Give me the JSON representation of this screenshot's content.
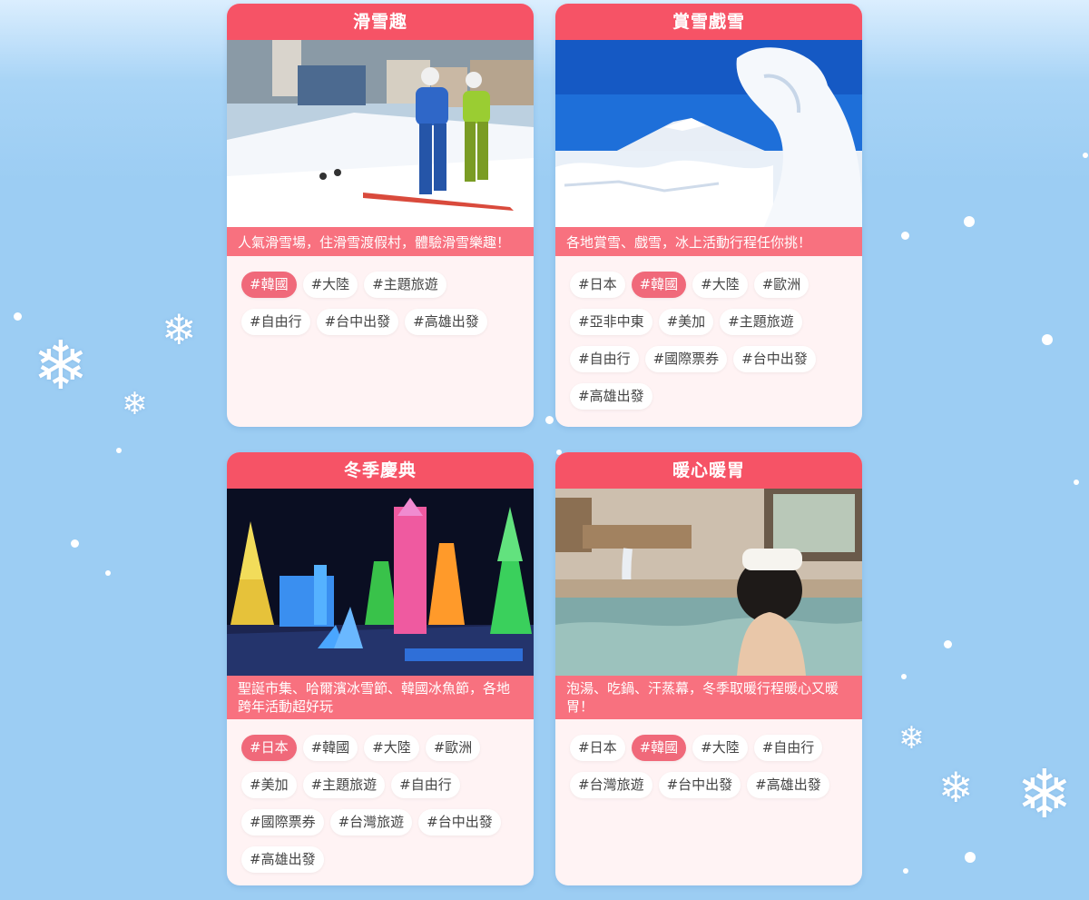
{
  "cards": [
    {
      "title": "滑雪趣",
      "photo_icon": "ski-resort-photo",
      "description": "人氣滑雪場，住滑雪渡假村，體驗滑雪樂趣！",
      "tags": [
        "#韓國",
        "#大陸",
        "#主題旅遊",
        "#自由行",
        "#台中出發",
        "#高雄出發"
      ],
      "active_tag": "#韓國"
    },
    {
      "title": "賞雪戲雪",
      "photo_icon": "snow-mountain-photo",
      "description": "各地賞雪、戲雪，冰上活動行程任你挑！",
      "tags": [
        "#日本",
        "#韓國",
        "#大陸",
        "#歐洲",
        "#亞非中東",
        "#美加",
        "#主題旅遊",
        "#自由行",
        "#國際票券",
        "#台中出發",
        "#高雄出發"
      ],
      "active_tag": "#韓國"
    },
    {
      "title": "冬季慶典",
      "photo_icon": "ice-festival-photo",
      "description": "聖誕市集、哈爾濱冰雪節、韓國冰魚節，各地跨年活動超好玩",
      "tags": [
        "#日本",
        "#韓國",
        "#大陸",
        "#歐洲",
        "#美加",
        "#主題旅遊",
        "#自由行",
        "#國際票券",
        "#台灣旅遊",
        "#台中出發",
        "#高雄出發"
      ],
      "active_tag": "#日本"
    },
    {
      "title": "暖心暖胃",
      "photo_icon": "hot-spring-photo",
      "description": "泡湯、吃鍋、汗蒸幕，冬季取暖行程暖心又暖胃！",
      "tags": [
        "#日本",
        "#韓國",
        "#大陸",
        "#自由行",
        "#台灣旅遊",
        "#台中出發",
        "#高雄出發"
      ],
      "active_tag": "#韓國"
    }
  ],
  "colors": {
    "header": "#f65366",
    "description_band": "#f8717f",
    "active_tag": "#f0697a",
    "card_body": "#fff3f4",
    "background": "#9ccdf3"
  },
  "decor": {
    "snowflake_icon": "snowflake-icon"
  }
}
